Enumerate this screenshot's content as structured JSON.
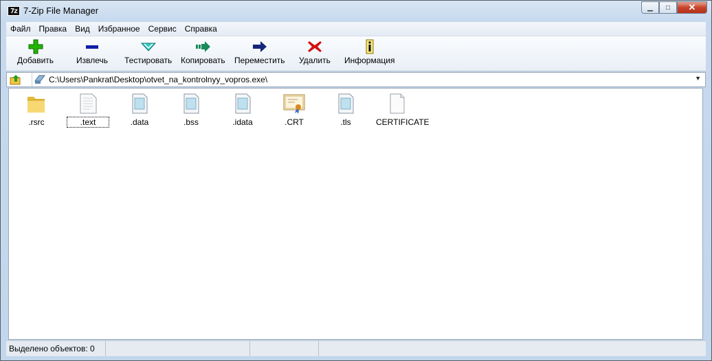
{
  "window": {
    "title": "7-Zip File Manager",
    "app_icon_text": "7z"
  },
  "controls": {
    "minimize": "▁",
    "maximize": "□",
    "close": "✕"
  },
  "menu": [
    "Файл",
    "Правка",
    "Вид",
    "Избранное",
    "Сервис",
    "Справка"
  ],
  "toolbar": [
    {
      "label": "Добавить",
      "icon": "add-icon",
      "color": "#22b400"
    },
    {
      "label": "Извлечь",
      "icon": "extract-icon",
      "color": "#1020a8"
    },
    {
      "label": "Тестировать",
      "icon": "test-icon",
      "color": "#33c8c0"
    },
    {
      "label": "Копировать",
      "icon": "copy-icon",
      "color": "#1a8a5a"
    },
    {
      "label": "Переместить",
      "icon": "move-icon",
      "color": "#14267a"
    },
    {
      "label": "Удалить",
      "icon": "delete-icon",
      "color": "#d41010"
    },
    {
      "label": "Информация",
      "icon": "info-icon",
      "color": "#d8b800"
    }
  ],
  "address": {
    "path": "C:\\Users\\Pankrat\\Desktop\\otvet_na_kontrolnyy_vopros.exe\\"
  },
  "files": [
    {
      "name": ".rsrc",
      "icon": "folder-icon"
    },
    {
      "name": ".text",
      "icon": "blank-file-icon"
    },
    {
      "name": ".data",
      "icon": "file-icon"
    },
    {
      "name": ".bss",
      "icon": "file-icon"
    },
    {
      "name": ".idata",
      "icon": "file-icon"
    },
    {
      "name": ".CRT",
      "icon": "certificate-icon"
    },
    {
      "name": ".tls",
      "icon": "file-icon"
    },
    {
      "name": "CERTIFICATE",
      "icon": "blank-file-icon"
    }
  ],
  "status": {
    "selected": "Выделено объектов: 0"
  }
}
